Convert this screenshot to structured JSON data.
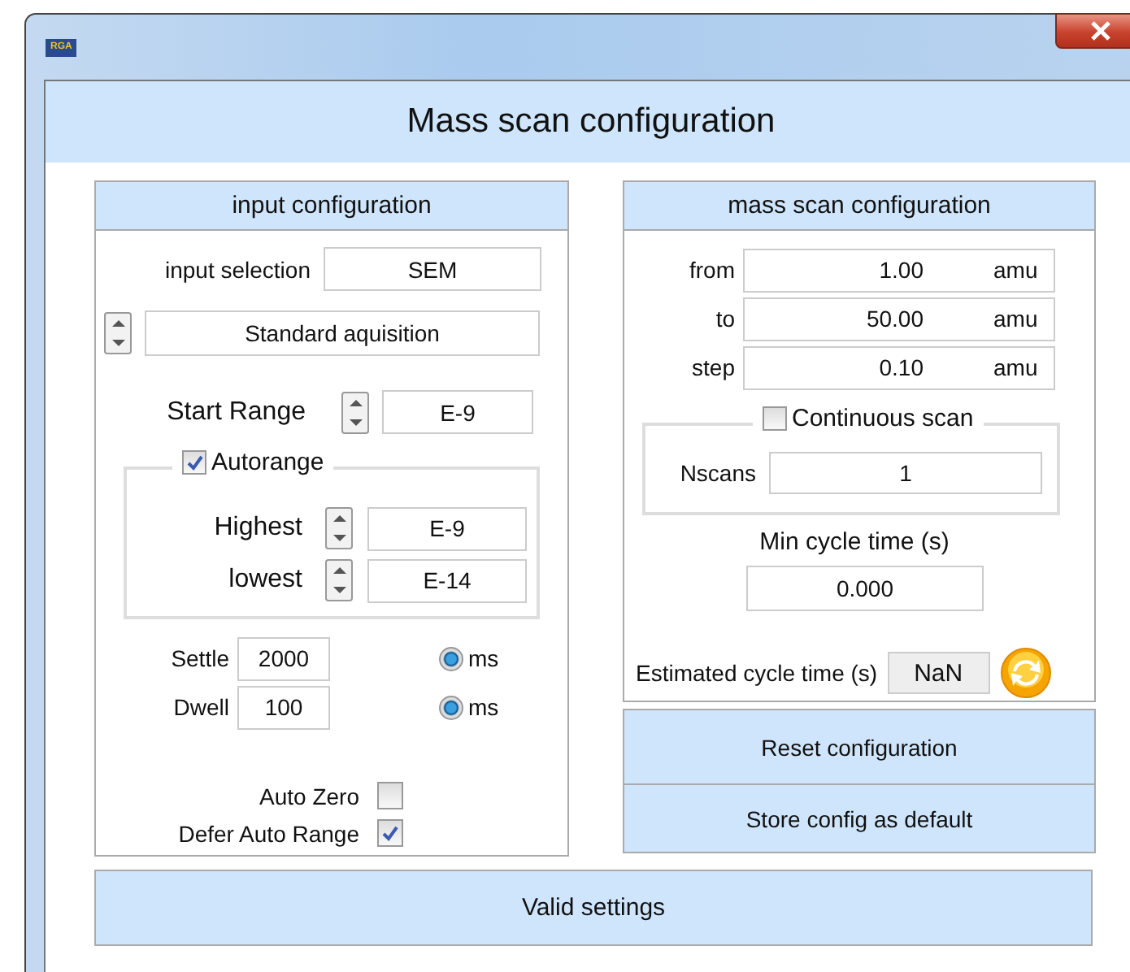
{
  "window": {
    "app_icon": "RGA",
    "title": "Mass scan configuration"
  },
  "input_configuration": {
    "title": "input configuration",
    "input_selection": {
      "label": "input selection",
      "value": "SEM"
    },
    "mode": {
      "value": "Standard aquisition"
    },
    "start_range": {
      "label": "Start Range",
      "value": "E-9"
    },
    "autorange": {
      "label": "Autorange",
      "checked": true,
      "highest": {
        "label": "Highest",
        "value": "E-9"
      },
      "lowest": {
        "label": "lowest",
        "value": "E-14"
      }
    },
    "timings": [
      {
        "label": "Settle",
        "value": "2000",
        "unit": "ms",
        "selected": true
      },
      {
        "label": "Dwell",
        "value": "100",
        "unit": "ms",
        "selected": true
      }
    ],
    "options": [
      {
        "label": "Auto Zero",
        "checked": false
      },
      {
        "label": "Defer Auto Range",
        "checked": true
      }
    ]
  },
  "mass_scan_configuration": {
    "title": "mass scan configuration",
    "range": [
      {
        "label": "from",
        "value": "1.00",
        "unit": "amu"
      },
      {
        "label": "to",
        "value": "50.00",
        "unit": "amu"
      },
      {
        "label": "step",
        "value": "0.10",
        "unit": "amu"
      }
    ],
    "continuous_scan": {
      "label": "Continuous scan",
      "checked": false,
      "nscans": {
        "label": "Nscans",
        "value": "1"
      }
    },
    "min_cycle_time": {
      "label": "Min cycle time (s)",
      "value": "0.000"
    },
    "estimated_cycle_time": {
      "label": "Estimated cycle time (s)",
      "value": "NaN"
    }
  },
  "side_buttons": [
    {
      "label": "Reset configuration"
    },
    {
      "label": "Store config as default"
    }
  ],
  "valid_button": {
    "label": "Valid settings"
  }
}
